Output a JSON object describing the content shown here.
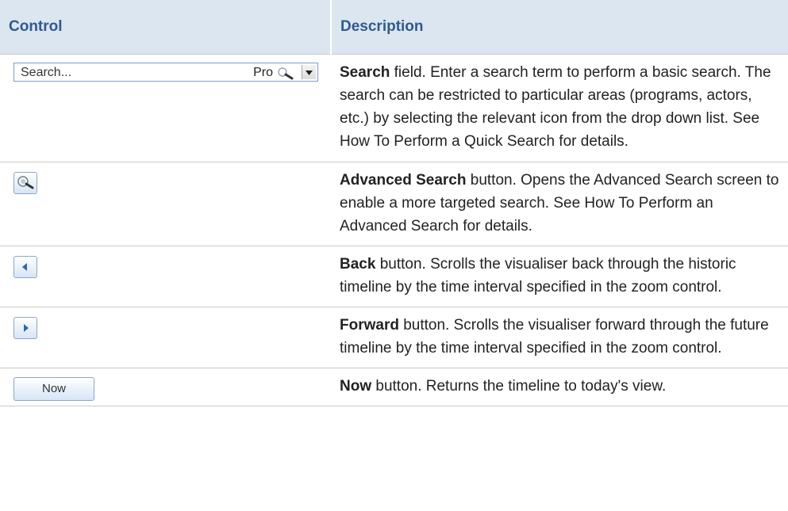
{
  "table": {
    "headers": {
      "control": "Control",
      "description": "Description"
    },
    "rows": [
      {
        "control_text": "Search...",
        "control_suffix": "Pro",
        "term": "Search",
        "text": " field. Enter a search term to perform a basic search. The search can be restricted to particular areas (programs, actors, etc.) by selecting the relevant icon from the drop down list. See How To Perform a Quick Search for details."
      },
      {
        "term": "Advanced Search",
        "text": " button. Opens the Advanced Search screen to enable a more targeted search. See How To Perform an Advanced Search for details."
      },
      {
        "term": "Back",
        "text": " button. Scrolls the visualiser back through the historic timeline by the time interval specified in the zoom control."
      },
      {
        "term": "Forward",
        "text": " button. Scrolls the visualiser forward through the future timeline by the time interval specified in the zoom control."
      },
      {
        "control_text": "Now",
        "term": "Now",
        "text": " button. Returns the timeline to today's view."
      }
    ]
  },
  "colors": {
    "header_bg": "#dce6f1",
    "header_text": "#2e5b8c",
    "border": "#c9c9c9",
    "button_border": "#8aa7c9"
  },
  "icons": [
    "magnifier-icon",
    "dropdown-arrow-icon",
    "advanced-search-icon",
    "back-arrow-icon",
    "forward-arrow-icon"
  ]
}
